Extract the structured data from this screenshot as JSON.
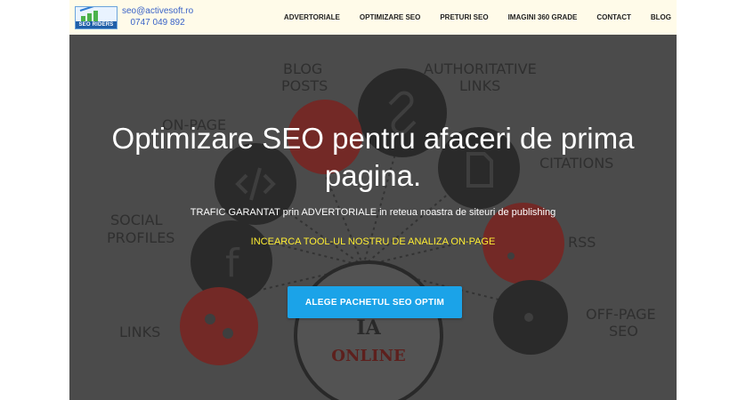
{
  "header": {
    "logo_text": "SEO RIDERS",
    "email": "seo@activesoft.ro",
    "phone": "0747 049 892"
  },
  "nav": {
    "items": [
      {
        "label": "ADVERTORIALE"
      },
      {
        "label": "OPTIMIZARE SEO"
      },
      {
        "label": "PRETURI SEO"
      },
      {
        "label": "IMAGINI 360 GRADE"
      },
      {
        "label": "CONTACT"
      },
      {
        "label": "BLOG"
      }
    ]
  },
  "hero": {
    "title": "Optimizare SEO pentru afaceri de prima pagina.",
    "subtitle": "TRAFIC GARANTAT prin ADVERTORIALE in reteua noastra de siteuri de publishing",
    "link": "INCEARCA TOOL-UL NOSTRU DE ANALIZA ON-PAGE",
    "cta": "ALEGE PACHETUL SEO OPTIM",
    "background_labels": {
      "blog_posts_1": "BLOG",
      "blog_posts_2": "POSTS",
      "authoritative_1": "AUTHORITATIVE",
      "authoritative_2": "LINKS",
      "on_page": "ON-PAGE",
      "citations": "CITATIONS",
      "social_1": "SOCIAL",
      "social_2": "PROFILES",
      "rss": "RSS",
      "links": "LINKS",
      "off_page_1": "OFF-PAGE",
      "off_page_2": "SEO",
      "center_1": "IA",
      "center_2": "ONLINE"
    },
    "colors": {
      "cta": "#1ba3e8",
      "link": "#ffee33",
      "red_circle": "#c9332b",
      "dark_circle": "#2d2d2d"
    }
  }
}
